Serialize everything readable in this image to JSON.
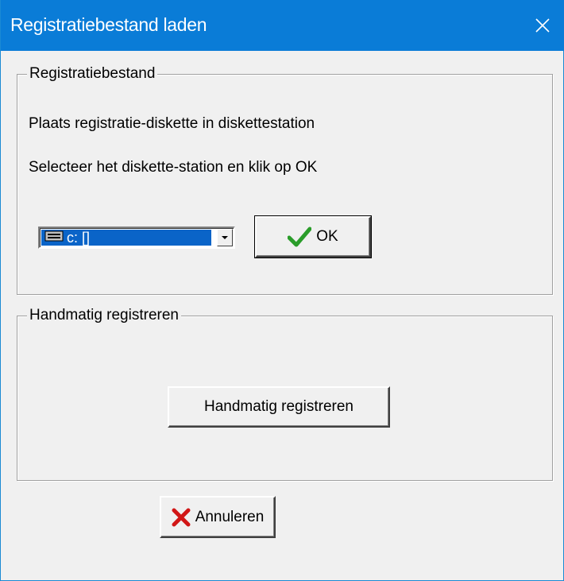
{
  "window": {
    "title": "Registratiebestand laden",
    "close_icon": "close-icon",
    "titlebar_color": "#0a7cd7"
  },
  "registration_file": {
    "legend": "Registratiebestand",
    "instruction_1": "Plaats registratie-diskette in diskettestation",
    "instruction_2": "Selecteer het diskette-station en klik op OK",
    "drive_select": {
      "selected": "c: []",
      "icon": "drive-icon"
    },
    "ok_button": {
      "label": "OK",
      "icon": "checkmark-icon"
    }
  },
  "manual_registration": {
    "legend": "Handmatig registreren",
    "button_label": "Handmatig registreren"
  },
  "cancel_button": {
    "label": "Annuleren",
    "icon": "red-x-icon"
  }
}
